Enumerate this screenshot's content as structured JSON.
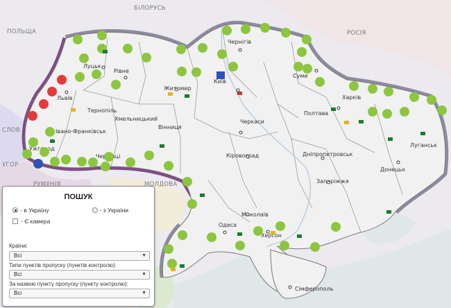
{
  "countries": {
    "belarus": "БІЛОРУСЬ",
    "poland": "ПОЛЬЩА",
    "russia": "РОСІЯ",
    "slovakia": "СЛОВ",
    "hungary": "УГОР",
    "romania": "РУМУНІЯ",
    "moldova": "МОЛДОВА"
  },
  "regions": {
    "lutsk": "Луцьк",
    "rivne": "Рівне",
    "lviv": "Львів",
    "ternopil": "Тернопіль",
    "ivano_frankivsk": "Івано-Франківськ",
    "uzhhorod": "Ужгород",
    "chernivtsi": "Чернівці",
    "khmelnytskyi": "Хмельницький",
    "vinnytsia": "Вінниця",
    "zhytomyr": "Житомир",
    "kyiv": "Київ",
    "chernihiv": "Чернігів",
    "sumy": "Суми",
    "kharkiv": "Харків",
    "poltava": "Полтава",
    "cherkasy": "Черкаси",
    "kirovohrad": "Кіровоград",
    "dnipropetrovsk": "Дніпропетровськ",
    "luhansk": "Луганськ",
    "donetsk": "Донецьк",
    "zaporizhzhia": "Запоріжжя",
    "mykolaiv": "Миколаїв",
    "odesa": "Одеса",
    "kherson": "Херсон",
    "simferopol": "Сімферополь"
  },
  "colors": {
    "border_band": "#8d8aa0",
    "border_band_west": "#7f4d86",
    "checkpoint_green": "#8cc63f",
    "checkpoint_red": "#e53a3a",
    "checkpoint_blue": "#2d52b8",
    "flag_green": "#1e7a2e",
    "flag_yellow": "#e3b320",
    "land": "#f1f1f1",
    "sea": "#dfe7e9"
  },
  "search": {
    "title": "ПОШУК",
    "radio_to": "- в Україну",
    "radio_from": "- з України",
    "camera": "- Є камера",
    "countries_label": "Країни:",
    "countries_value": "Всі",
    "types_label": "Типи пунктів пропуску (пунктів контролю):",
    "types_value": "Всі",
    "name_label": "За назвою пункту пропуску (пункту контролю):",
    "name_value": "Всі"
  }
}
